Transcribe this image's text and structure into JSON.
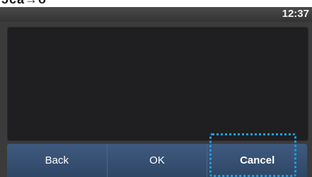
{
  "header_fragment": "ɔca→o",
  "status_bar": {
    "time": "12:37"
  },
  "softkeys": [
    {
      "label": "Back"
    },
    {
      "label": "OK"
    },
    {
      "label": "Cancel"
    }
  ],
  "colors": {
    "softkey_bar": "#3a5276",
    "screen_panel": "#1f1f22",
    "highlight": "#1ea0e0"
  }
}
